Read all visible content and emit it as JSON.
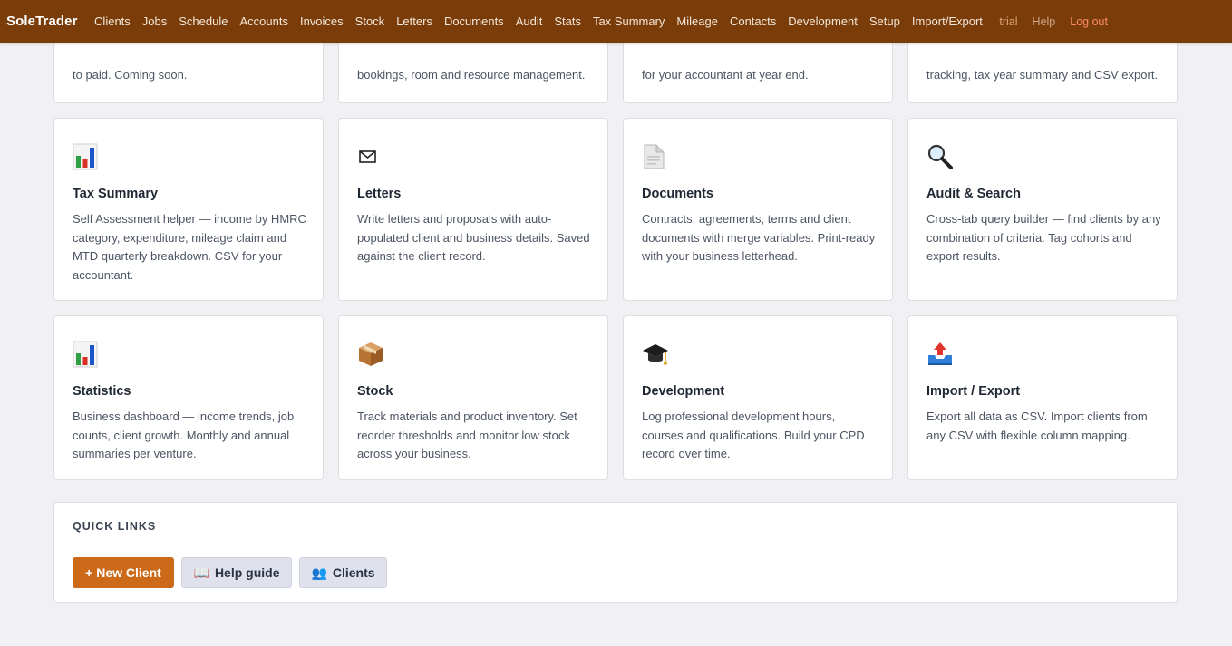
{
  "nav": {
    "brand": "SoleTrader",
    "items": [
      "Clients",
      "Jobs",
      "Schedule",
      "Accounts",
      "Invoices",
      "Stock",
      "Letters",
      "Documents",
      "Audit",
      "Stats",
      "Tax Summary",
      "Mileage",
      "Contacts",
      "Development",
      "Setup",
      "Import/Export"
    ],
    "trial": "trial",
    "help": "Help",
    "logout": "Log out"
  },
  "partial_cards": [
    {
      "desc": "to paid. Coming soon."
    },
    {
      "desc": "bookings, room and resource management."
    },
    {
      "desc": "for your accountant at year end."
    },
    {
      "desc": "tracking, tax year summary and CSV export."
    }
  ],
  "cards": [
    {
      "icon": "bar-chart-icon",
      "title": "Tax Summary",
      "desc": "Self Assessment helper — income by HMRC category, expenditure, mileage claim and MTD quarterly breakdown. CSV for your accountant."
    },
    {
      "icon": "envelope-icon",
      "title": "Letters",
      "desc": "Write letters and proposals with auto-populated client and business details. Saved against the client record."
    },
    {
      "icon": "document-icon",
      "title": "Documents",
      "desc": "Contracts, agreements, terms and client documents with merge variables. Print-ready with your business letterhead."
    },
    {
      "icon": "magnifier-icon",
      "title": "Audit & Search",
      "desc": "Cross-tab query builder — find clients by any combination of criteria. Tag cohorts and export results."
    },
    {
      "icon": "bar-chart-icon",
      "title": "Statistics",
      "desc": "Business dashboard — income trends, job counts, client growth. Monthly and annual summaries per venture."
    },
    {
      "icon": "package-icon",
      "title": "Stock",
      "desc": "Track materials and product inventory. Set reorder thresholds and monitor low stock across your business."
    },
    {
      "icon": "graduation-cap-icon",
      "title": "Development",
      "desc": "Log professional development hours, courses and qualifications. Build your CPD record over time."
    },
    {
      "icon": "outbox-tray-icon",
      "title": "Import / Export",
      "desc": "Export all data as CSV. Import clients from any CSV with flexible column mapping."
    }
  ],
  "quick_links": {
    "title": "QUICK LINKS",
    "new_client": "+ New Client",
    "help_guide": "Help guide",
    "help_glyph": "📖",
    "clients": "Clients",
    "clients_glyph": "👥"
  }
}
